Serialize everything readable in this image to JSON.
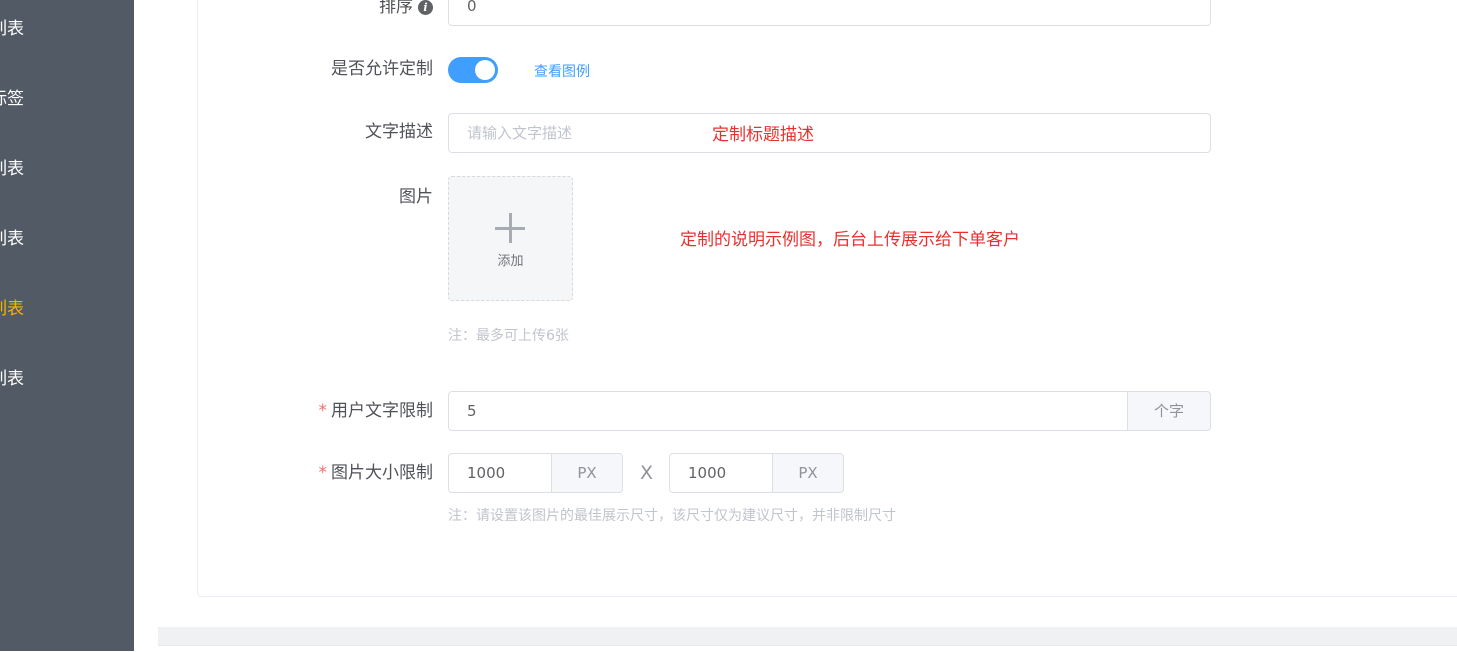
{
  "sidebar": {
    "items": [
      {
        "label": "列表",
        "active": false
      },
      {
        "label": "标签",
        "active": false
      },
      {
        "label": "列表",
        "active": false
      },
      {
        "label": "列表",
        "active": false
      },
      {
        "label": "列表",
        "active": true
      },
      {
        "label": "列表",
        "active": false
      }
    ]
  },
  "form": {
    "sort": {
      "label": "排序",
      "value": "0"
    },
    "allow_custom": {
      "label": "是否允许定制",
      "enabled": true,
      "link": "查看图例"
    },
    "text_desc": {
      "label": "文字描述",
      "placeholder": "请输入文字描述",
      "annotation": "定制标题描述"
    },
    "image": {
      "label": "图片",
      "upload_label": "添加",
      "annotation": "定制的说明示例图，后台上传展示给下单客户",
      "hint": "注：最多可上传6张"
    },
    "text_limit": {
      "required_mark": "*",
      "label": "用户文字限制",
      "value": "5",
      "unit": "个字"
    },
    "image_size": {
      "required_mark": "*",
      "label": "图片大小限制",
      "width": "1000",
      "height": "1000",
      "unit": "PX",
      "separator": "X",
      "hint": "注：请设置该图片的最佳展示尺寸，该尺寸仅为建议尺寸，并非限制尺寸"
    }
  },
  "colors": {
    "sidebar_bg": "#515a65",
    "sidebar_active": "#f5b400",
    "primary": "#409eff",
    "annotation_red": "#e8312f",
    "required_red": "#f56c6c"
  }
}
